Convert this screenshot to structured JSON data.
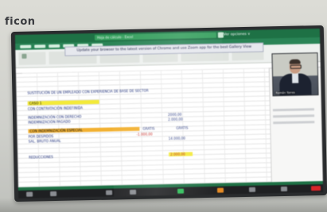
{
  "photo": {
    "brand_text": "ficon",
    "description_colors": {
      "excel_green": "#1e7145",
      "highlight_yellow": "#f3ea3a",
      "highlight_orange": "#f2b132"
    }
  },
  "excel": {
    "title_text": "Hoja de cálculo - Excel",
    "save_status": "Ver opciones ∨",
    "banner_text": "Update your browser to the latest version of Chrome and use Zoom app for the best Gallery View"
  },
  "sheet": {
    "heading": "CASO 1",
    "rows": [
      {
        "label": "SUSTITUCIÓN DE UN EMPLEADO CON EXPERIENCIA DE BASE DE SECTOR",
        "emphasis": "blue"
      },
      {
        "label": "CASO 1",
        "emphasis": "yellow"
      },
      {
        "label": "CON CONTRATACIÓN INDEFINIDA",
        "emphasis": "blue"
      },
      {
        "label": "INDEMNIZACIÓN CON DERECHO",
        "value": "2000,00"
      },
      {
        "label": "INDEMNIZACIÓN PAGADO",
        "value": "2.000,00"
      },
      {
        "label": "CON INDEMNIZACIÓN ESPECIAL",
        "emphasis": "orange"
      },
      {
        "label": "POR DESPIDOS",
        "value": "-1.000,00"
      },
      {
        "label": "SAL. BRUTO ANUAL",
        "value": "14.000,00"
      },
      {
        "label": "REDUCCIONES",
        "value": "2.000,00"
      }
    ],
    "col_totals": [
      "GRATIS",
      "GRATIS"
    ]
  },
  "video": {
    "participant_name": "Ramón Torres"
  }
}
